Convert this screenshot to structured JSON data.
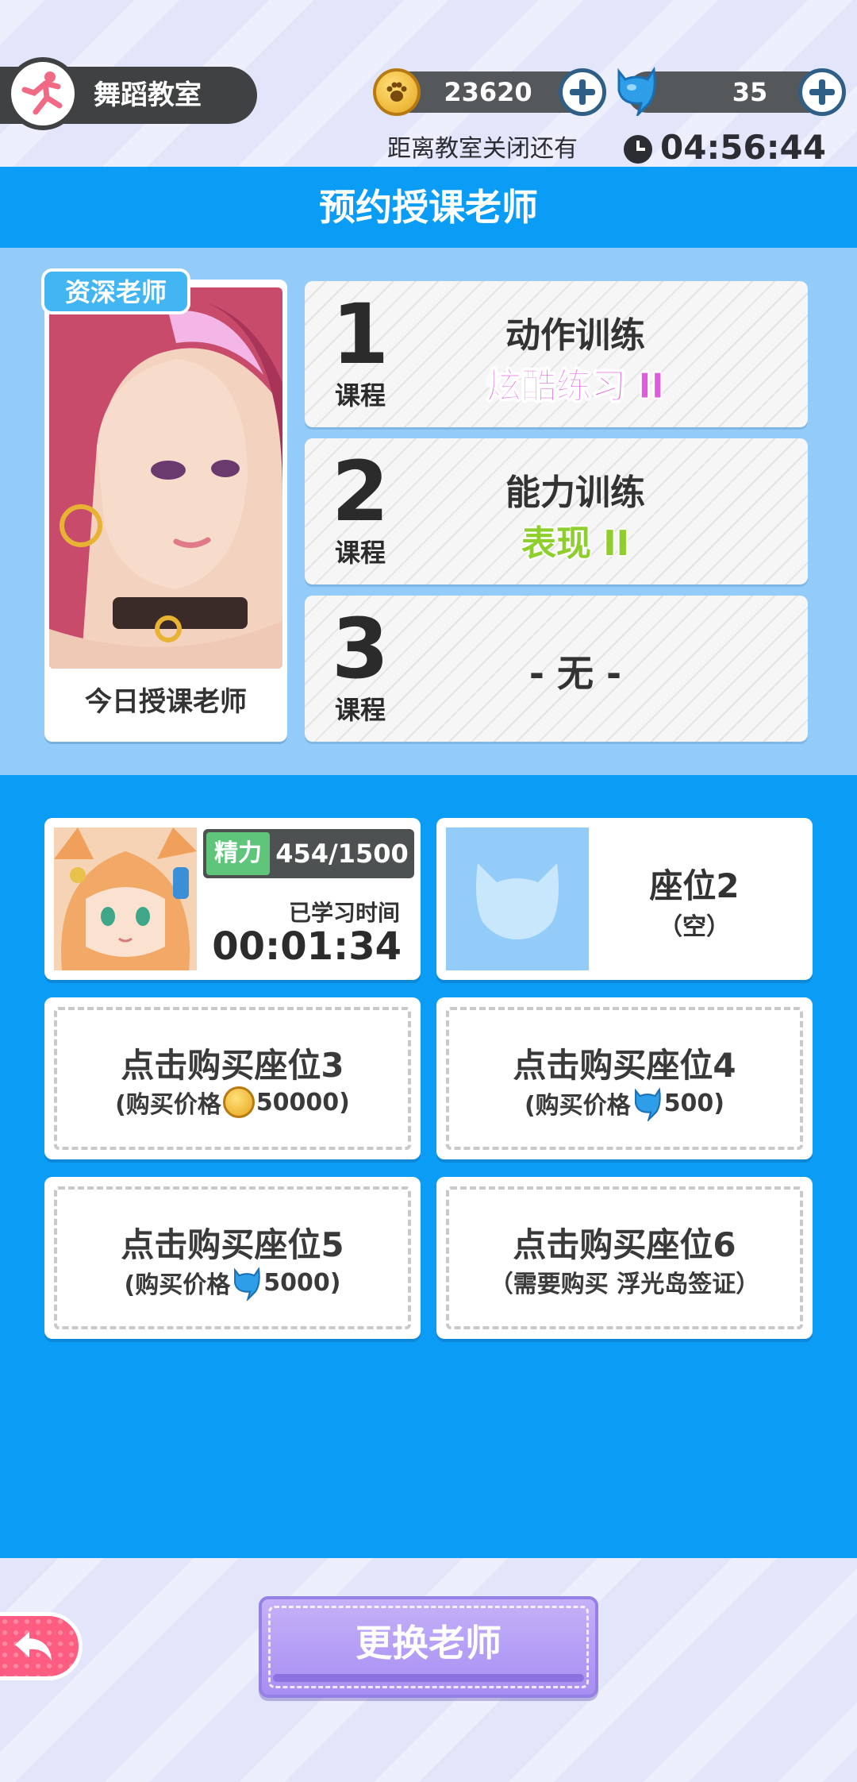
{
  "top_bar": {
    "classroom_title": "舞蹈教室",
    "coins": "23620",
    "gems": "35",
    "close_label": "距离教室关闭还有",
    "countdown": "04:56:44"
  },
  "header": {
    "title": "预约授课老师"
  },
  "teacher": {
    "badge": "资深老师",
    "caption": "今日授课老师"
  },
  "courses": [
    {
      "number": "1",
      "label": "课程",
      "title": "动作训练",
      "subtitle": "炫酷练习 II"
    },
    {
      "number": "2",
      "label": "课程",
      "title": "能力训练",
      "subtitle": "表现 II"
    },
    {
      "number": "3",
      "label": "课程",
      "title": "- 无 -"
    }
  ],
  "seats": {
    "seat1": {
      "energy_tag": "精力",
      "energy_value": "454/1500",
      "learned_label": "已学习时间",
      "learned_time": "00:01:34"
    },
    "seat2": {
      "title": "座位2",
      "status": "（空）"
    },
    "seat3": {
      "title": "点击购买座位3",
      "price_prefix": "(购买价格",
      "price_value": "50000)",
      "currency": "coin"
    },
    "seat4": {
      "title": "点击购买座位4",
      "price_prefix": "(购买价格",
      "price_value": "500)",
      "currency": "gem"
    },
    "seat5": {
      "title": "点击购买座位5",
      "price_prefix": "(购买价格",
      "price_value": "5000)",
      "currency": "gem"
    },
    "seat6": {
      "title": "点击购买座位6",
      "requirement": "（需要购买 浮光岛签证）"
    }
  },
  "buttons": {
    "change_teacher": "更换老师"
  },
  "colors": {
    "header_blue": "#0b9cf5",
    "panel_light_blue": "#93ccf8",
    "button_purple": "#a78ef2",
    "back_pink": "#ff5c82"
  }
}
